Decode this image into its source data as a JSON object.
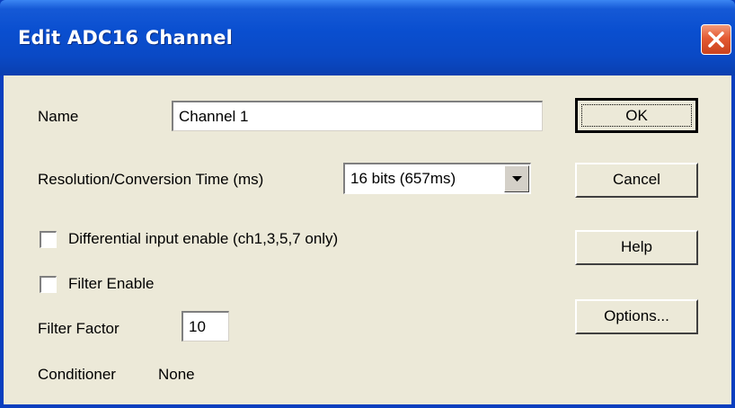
{
  "dialog": {
    "title": "Edit ADC16 Channel",
    "close_icon": "close-icon"
  },
  "form": {
    "name_label": "Name",
    "name_value": "Channel 1",
    "resolution_label": "Resolution/Conversion Time (ms)",
    "resolution_value": "16 bits (657ms)",
    "differential_label": "Differential input enable (ch1,3,5,7 only)",
    "differential_checked": false,
    "filter_enable_label": "Filter Enable",
    "filter_enable_checked": false,
    "filter_factor_label": "Filter Factor",
    "filter_factor_value": "10",
    "conditioner_label": "Conditioner",
    "conditioner_value": "None"
  },
  "buttons": {
    "ok": "OK",
    "cancel": "Cancel",
    "help": "Help",
    "options": "Options..."
  },
  "colors": {
    "titlebar": "#0a4fd0",
    "dialog_bg": "#ece9d8",
    "close_button": "#e45a33"
  }
}
